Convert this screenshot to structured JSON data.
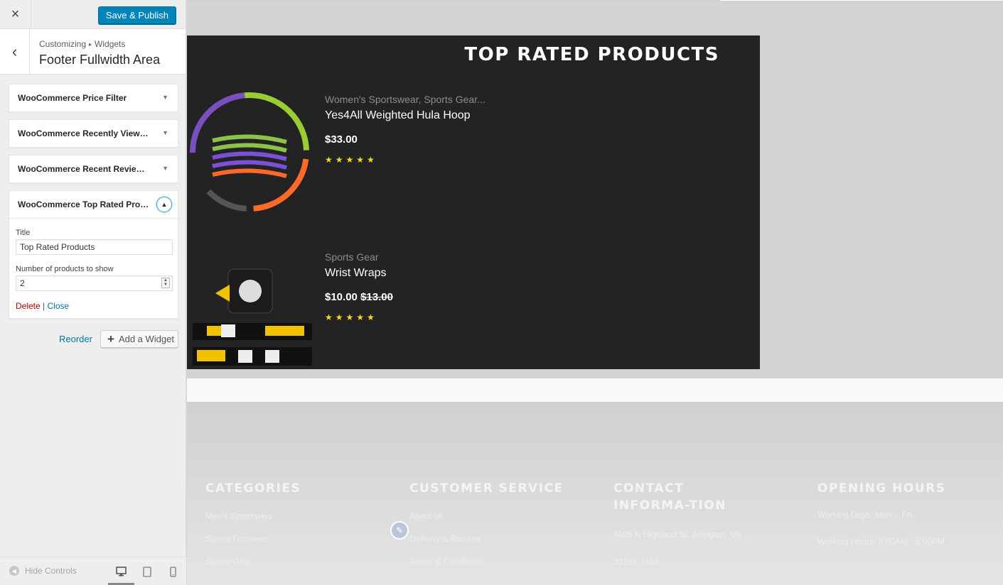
{
  "header": {
    "close_label": "×",
    "save_label": "Save & Publish"
  },
  "section": {
    "back_label": "‹",
    "breadcrumb_1": "Customizing",
    "breadcrumb_sep": "▸",
    "breadcrumb_2": "Widgets",
    "title": "Footer Fullwidth Area"
  },
  "widgets": [
    {
      "name": "WooCommerce Price Filter",
      "toggle": "▼"
    },
    {
      "name": "WooCommerce Recently Viewed",
      "toggle": "▼"
    },
    {
      "name": "WooCommerce Recent Reviews:...",
      "toggle": "▼"
    },
    {
      "name": "WooCommerce Top Rated Prod...",
      "toggle": "▲"
    }
  ],
  "open_widget": {
    "title_label": "Title",
    "title_value": "Top Rated Products",
    "count_label": "Number of products to show",
    "count_value": "2",
    "delete_label": "Delete",
    "separator": "|",
    "close_label": "Close"
  },
  "actions": {
    "reorder_label": "Reorder",
    "add_widget_label": "Add a Widget",
    "add_icon": "+"
  },
  "footer_controls": {
    "hide_label": "Hide Controls",
    "hide_icon": "◀",
    "desktop_icon": "🖥",
    "tablet_icon": "▯",
    "mobile_icon": "▯"
  },
  "preview": {
    "products_title": "TOP RATED PRODUCTS",
    "products": [
      {
        "category": "Women's Sportswear, Sports Gear...",
        "name": "Yes4All Weighted Hula Hoop",
        "price": "$33.00",
        "old_price": "",
        "rating": 5,
        "stars": "★★★★★",
        "image": "hula-hoop"
      },
      {
        "category": "Sports Gear",
        "name": "Wrist Wraps",
        "price": "$10.00",
        "old_price": "$13.00",
        "rating": 5,
        "stars": "★★★★★",
        "image": "wrist-wraps"
      }
    ],
    "footer_columns": [
      {
        "heading": "CATEGORIES",
        "links": [
          "Men's Sportswear",
          "Sports Footwear",
          "Sports Gear"
        ]
      },
      {
        "heading": "CUSTOMER SERVICE",
        "links": [
          "About us",
          "Delivery & Returns",
          "Terms & Conditions"
        ]
      },
      {
        "heading": "CONTACT INFORMA-TION",
        "links": [
          "4096 N Highland St, Arlington, VA",
          "32101, USA"
        ]
      },
      {
        "heading": "OPENING HOURS",
        "links": [
          "Working Days: Mon. - Fri.",
          "Working Hours: 9.00AM - 5.00PM"
        ]
      }
    ],
    "edit_icon": "✎"
  },
  "colors": {
    "primary": "#0085ba",
    "link": "#0073aa",
    "delete": "#aa0000",
    "star": "#f9d71c",
    "panel_bg": "#232323"
  }
}
